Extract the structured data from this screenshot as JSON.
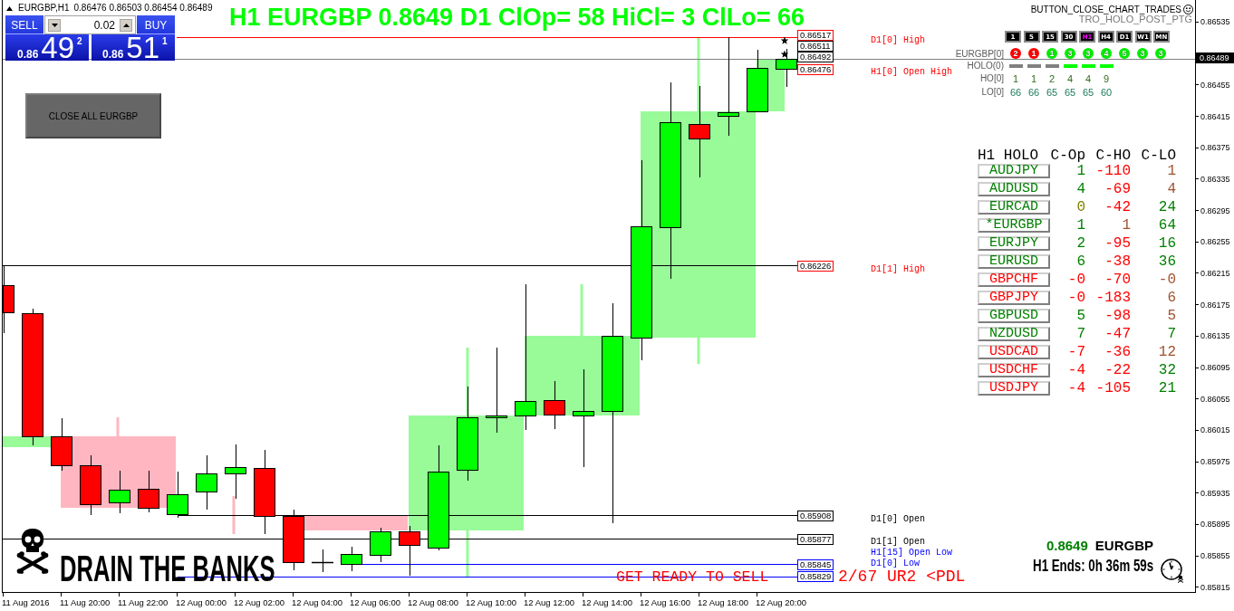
{
  "symbol_bar": {
    "symbol": "EURGBP,H1",
    "quotes": "0.86476 0.86503 0.86454 0.86489"
  },
  "trade_panel": {
    "sell_label": "SELL",
    "buy_label": "BUY",
    "lot": "0.02",
    "sell_quote": {
      "prefix": "0.86",
      "pips": "49",
      "fraction": "2"
    },
    "buy_quote": {
      "prefix": "0.86",
      "pips": "51",
      "fraction": "1"
    }
  },
  "close_button": "CLOSE ALL EURGBP",
  "headline": "H1 EURGBP 0.8649 D1 ClOp= 58 HiCl= 3 ClLo= 66",
  "script_labels": {
    "button": "BUTTON_CLOSE_CHART_TRADES",
    "indicator": "TRO_HOLO_POST_PTG"
  },
  "timeframes": [
    {
      "label": "1",
      "selected": false
    },
    {
      "label": "5",
      "selected": false
    },
    {
      "label": "15",
      "selected": false
    },
    {
      "label": "30",
      "selected": false
    },
    {
      "label": "H1",
      "selected": true
    },
    {
      "label": "H4",
      "selected": false
    },
    {
      "label": "D1",
      "selected": false
    },
    {
      "label": "W1",
      "selected": false
    },
    {
      "label": "MN",
      "selected": false
    }
  ],
  "strength": {
    "label": "EURGBP[0]",
    "badges": [
      {
        "text": "2",
        "color": "#ff0000"
      },
      {
        "text": "1",
        "color": "#ff0000"
      },
      {
        "text": "1",
        "color": "#00ee00"
      },
      {
        "text": "3",
        "color": "#00ee00"
      },
      {
        "text": "3",
        "color": "#00ee00"
      },
      {
        "text": "4",
        "color": "#00ee00"
      },
      {
        "text": "5",
        "color": "#00ee00"
      },
      {
        "text": "3",
        "color": "#00ee00"
      },
      {
        "text": "3",
        "color": "#00ee00"
      }
    ]
  },
  "holo": {
    "label": "HOLO(0)",
    "bars": [
      {
        "color": "#808080"
      },
      {
        "color": "#808080"
      },
      {
        "color": "#808080"
      },
      {
        "color": "#00ff00"
      },
      {
        "color": "#00ff00"
      },
      {
        "color": "#00ff00"
      }
    ]
  },
  "ho": {
    "label": "HO[0]",
    "values": [
      "1",
      "1",
      "2",
      "4",
      "4",
      "9"
    ]
  },
  "lo": {
    "label": "LO[0]",
    "values": [
      "66",
      "66",
      "65",
      "65",
      "65",
      "60"
    ]
  },
  "holo_table": {
    "columns": [
      "H1 HOLO",
      "C-Op",
      "C-HO",
      "C-LO"
    ],
    "rows": [
      {
        "cells": [
          {
            "text": "AUDJPY",
            "color": "#008000"
          },
          {
            "text": "1",
            "color": "#008000"
          },
          {
            "text": "-110",
            "color": "#ff0000"
          },
          {
            "text": "1",
            "color": "#a0522d"
          }
        ]
      },
      {
        "cells": [
          {
            "text": "AUDUSD",
            "color": "#008000"
          },
          {
            "text": "4",
            "color": "#008000"
          },
          {
            "text": "-69",
            "color": "#ff0000"
          },
          {
            "text": "4",
            "color": "#a0522d"
          }
        ]
      },
      {
        "cells": [
          {
            "text": "EURCAD",
            "color": "#008000"
          },
          {
            "text": "0",
            "color": "#808000"
          },
          {
            "text": "-42",
            "color": "#ff0000"
          },
          {
            "text": "24",
            "color": "#008000"
          }
        ]
      },
      {
        "cells": [
          {
            "text": "*EURGBP",
            "color": "#008000"
          },
          {
            "text": "1",
            "color": "#008000"
          },
          {
            "text": "1",
            "color": "#a0522d"
          },
          {
            "text": "64",
            "color": "#008000"
          }
        ]
      },
      {
        "cells": [
          {
            "text": "EURJPY",
            "color": "#008000"
          },
          {
            "text": "2",
            "color": "#008000"
          },
          {
            "text": "-95",
            "color": "#ff0000"
          },
          {
            "text": "16",
            "color": "#008000"
          }
        ]
      },
      {
        "cells": [
          {
            "text": "EURUSD",
            "color": "#008000"
          },
          {
            "text": "6",
            "color": "#008000"
          },
          {
            "text": "-38",
            "color": "#ff0000"
          },
          {
            "text": "36",
            "color": "#008000"
          }
        ]
      },
      {
        "cells": [
          {
            "text": "GBPCHF",
            "color": "#ff0000"
          },
          {
            "text": "-0",
            "color": "#ff0000"
          },
          {
            "text": "-70",
            "color": "#ff0000"
          },
          {
            "text": "-0",
            "color": "#a0522d"
          }
        ]
      },
      {
        "cells": [
          {
            "text": "GBPJPY",
            "color": "#ff0000"
          },
          {
            "text": "-0",
            "color": "#ff0000"
          },
          {
            "text": "-183",
            "color": "#ff0000"
          },
          {
            "text": "6",
            "color": "#a0522d"
          }
        ]
      },
      {
        "cells": [
          {
            "text": "GBPUSD",
            "color": "#008000"
          },
          {
            "text": "5",
            "color": "#008000"
          },
          {
            "text": "-98",
            "color": "#ff0000"
          },
          {
            "text": "5",
            "color": "#a0522d"
          }
        ]
      },
      {
        "cells": [
          {
            "text": "NZDUSD",
            "color": "#008000"
          },
          {
            "text": "7",
            "color": "#008000"
          },
          {
            "text": "-47",
            "color": "#ff0000"
          },
          {
            "text": "7",
            "color": "#008000"
          }
        ]
      },
      {
        "cells": [
          {
            "text": "USDCAD",
            "color": "#ff0000"
          },
          {
            "text": "-7",
            "color": "#ff0000"
          },
          {
            "text": "-36",
            "color": "#ff0000"
          },
          {
            "text": "12",
            "color": "#a0522d"
          }
        ]
      },
      {
        "cells": [
          {
            "text": "USDCHF",
            "color": "#ff0000"
          },
          {
            "text": "-4",
            "color": "#ff0000"
          },
          {
            "text": "-22",
            "color": "#ff0000"
          },
          {
            "text": "32",
            "color": "#008000"
          }
        ]
      },
      {
        "cells": [
          {
            "text": "USDJPY",
            "color": "#ff0000"
          },
          {
            "text": "-4",
            "color": "#ff0000"
          },
          {
            "text": "-105",
            "color": "#ff0000"
          },
          {
            "text": "21",
            "color": "#008000"
          }
        ]
      }
    ]
  },
  "price_tags": [
    {
      "text": "0.86517",
      "color": "#ff0000"
    },
    {
      "text": "0.86511",
      "color": "#000000"
    },
    {
      "text": "0.86492",
      "color": "#000000"
    },
    {
      "text": "0.86476",
      "color": "#ff0000"
    },
    {
      "text": "0.86226",
      "color": "#ff0000"
    },
    {
      "text": "0.85908",
      "color": "#000000"
    },
    {
      "text": "0.85877",
      "color": "#000000"
    },
    {
      "text": "0.85845",
      "color": "#0000ff"
    },
    {
      "text": "0.85829",
      "color": "#0000ff"
    }
  ],
  "level_labels": [
    {
      "text": "D1[0] High",
      "color": "#ff0000"
    },
    {
      "text": "H1[0] Open High",
      "color": "#ff0000"
    },
    {
      "text": "D1[1] High",
      "color": "#ff0000"
    },
    {
      "text": "D1[0] Open",
      "color": "#000000"
    },
    {
      "text": "D1[1] Open",
      "color": "#000000"
    },
    {
      "text": "H1[15] Open Low",
      "color": "#0000ff"
    },
    {
      "text": "D1[0] Low",
      "color": "#0000ff"
    }
  ],
  "alert": {
    "text": "GET READY TO SELL",
    "detail": "2/67 UR2 <PDL"
  },
  "logo": "DRAIN THE BANKS",
  "info": {
    "price": "0.8649",
    "symbol": "EURGBP",
    "countdown": "H1 Ends: 0h 36m 59s"
  },
  "price_axis": {
    "labels": [
      "0.86535",
      "0.86455",
      "0.86415",
      "0.86375",
      "0.86335",
      "0.86295",
      "0.86255",
      "0.86215",
      "0.86175",
      "0.86135",
      "0.86095",
      "0.86055",
      "0.86015",
      "0.85975",
      "0.85935",
      "0.85895",
      "0.85855",
      "0.85815"
    ],
    "current": "0.86489"
  },
  "time_axis": {
    "labels": [
      "11 Aug 2016",
      "11 Aug 20:00",
      "11 Aug 22:00",
      "12 Aug 00:00",
      "12 Aug 02:00",
      "12 Aug 04:00",
      "12 Aug 06:00",
      "12 Aug 08:00",
      "12 Aug 10:00",
      "12 Aug 12:00",
      "12 Aug 14:00",
      "12 Aug 16:00",
      "12 Aug 18:00",
      "12 Aug 20:00"
    ]
  }
}
